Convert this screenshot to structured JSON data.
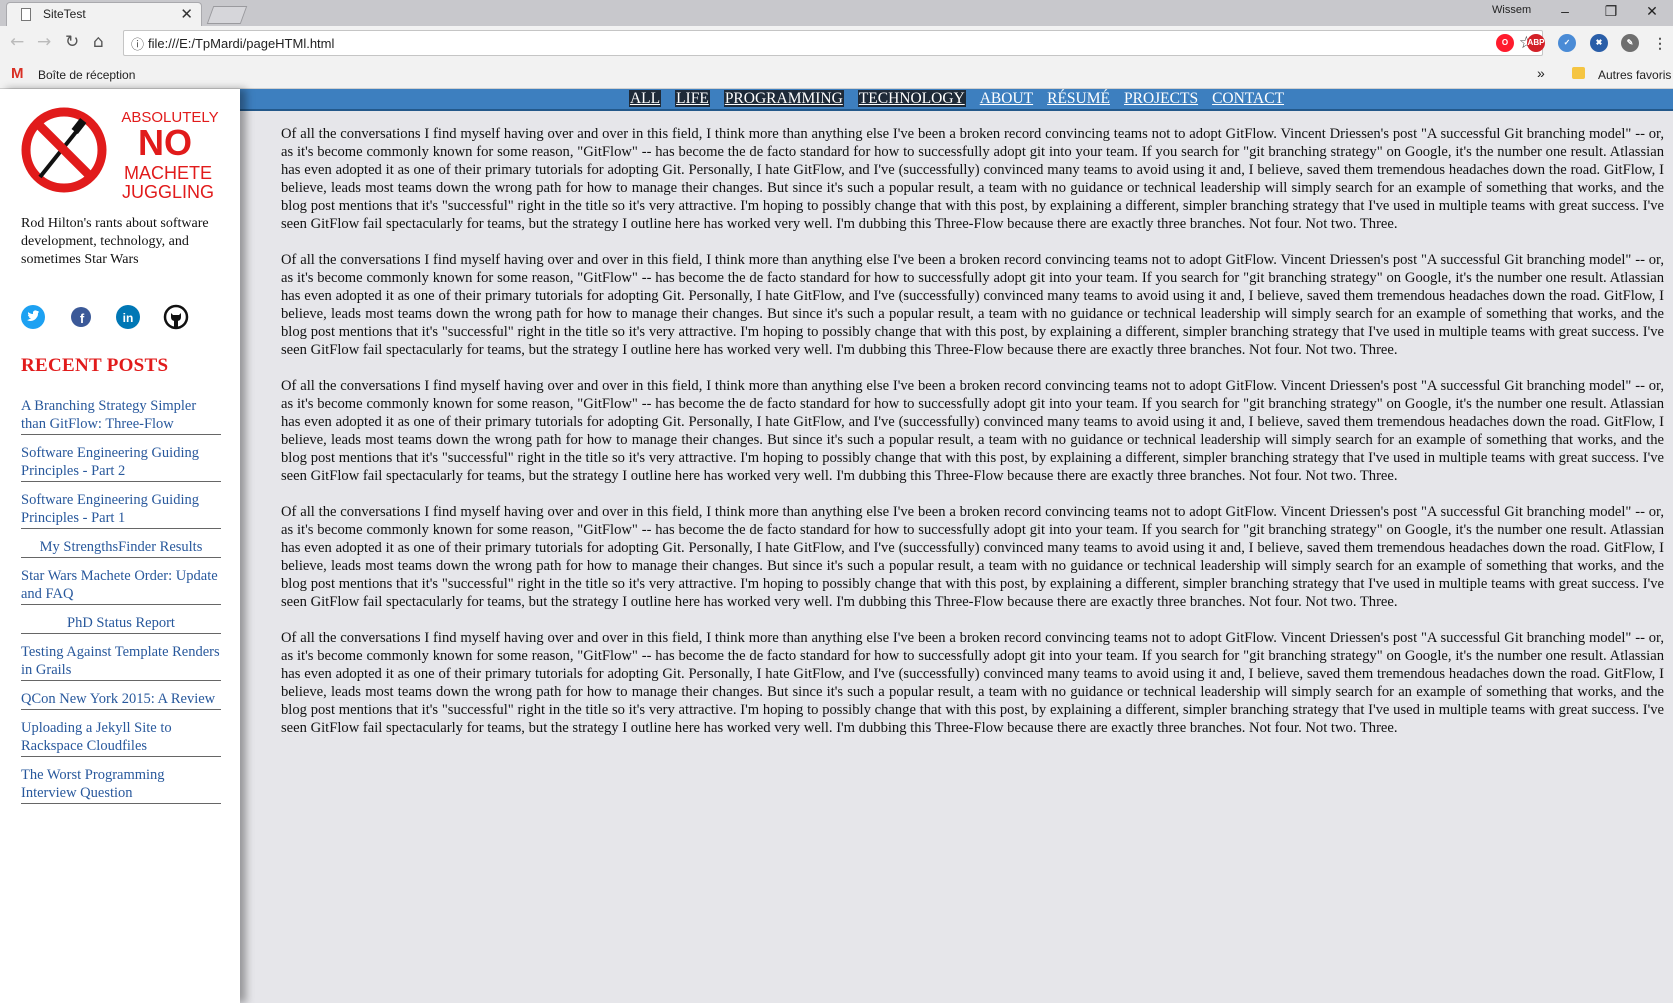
{
  "browser": {
    "tab_title": "SiteTest",
    "tab_close": "✕",
    "user_name": "Wissem",
    "url": "file:///E:/TpMardi/pageHTMl.html",
    "bookmark_gmail": "Boîte de réception",
    "bookmark_more": "»",
    "bookmark_other": "Autres favoris",
    "extensions": [
      "opera-icon",
      "adblock-plus-icon",
      "shield-icon",
      "globe-icon",
      "pen-icon"
    ]
  },
  "nav": {
    "items": [
      {
        "label": "ALL",
        "active": true
      },
      {
        "label": "LIFE",
        "active": true
      },
      {
        "label": "PROGRAMMING",
        "active": true
      },
      {
        "label": "TECHNOLOGY",
        "active": true
      },
      {
        "label": "ABOUT",
        "active": false
      },
      {
        "label": "RÉSUMÉ",
        "active": false
      },
      {
        "label": "PROJECTS",
        "active": false
      },
      {
        "label": "CONTACT",
        "active": false
      }
    ]
  },
  "sidebar": {
    "logo": {
      "line1": "ABSOLUTELY",
      "line2": "NO",
      "line3": "MACHETE",
      "line4": "JUGGLING",
      "color": "#e11b1b"
    },
    "tagline": "Rod Hilton's rants about software development, technology, and sometimes Star Wars",
    "social": [
      "twitter-icon",
      "facebook-icon",
      "linkedin-icon",
      "github-icon"
    ],
    "recent_title": "RECENT POSTS",
    "posts": [
      {
        "title": "A Branching Strategy Simpler than GitFlow: Three-Flow",
        "centered": false
      },
      {
        "title": "Software Engineering Guiding Principles - Part 2",
        "centered": false
      },
      {
        "title": "Software Engineering Guiding Principles - Part 1",
        "centered": false
      },
      {
        "title": "My StrengthsFinder Results",
        "centered": true
      },
      {
        "title": "Star Wars Machete Order: Update and FAQ",
        "centered": false
      },
      {
        "title": "PhD Status Report",
        "centered": true
      },
      {
        "title": "Testing Against Template Renders in Grails",
        "centered": false
      },
      {
        "title": "QCon New York 2015: A Review",
        "centered": false
      },
      {
        "title": "Uploading a Jekyll Site to Rackspace Cloudfiles",
        "centered": false
      },
      {
        "title": "The Worst Programming Interview Question",
        "centered": false
      }
    ]
  },
  "content": {
    "paragraphs": [
      "Of all the conversations I find myself having over and over in this field, I think more than anything else I've been a broken record convincing teams not to adopt GitFlow. Vincent Driessen's post \"A successful Git branching model\" -- or, as it's become commonly known for some reason, \"GitFlow\" -- has become the de facto standard for how to successfully adopt git into your team. If you search for \"git branching strategy\" on Google, it's the number one result. Atlassian has even adopted it as one of their primary tutorials for adopting Git. Personally, I hate GitFlow, and I've (successfully) convinced many teams to avoid using it and, I believe, saved them tremendous headaches down the road. GitFlow, I believe, leads most teams down the wrong path for how to manage their changes. But since it's such a popular result, a team with no guidance or technical leadership will simply search for an example of something that works, and the blog post mentions that it's \"successful\" right in the title so it's very attractive. I'm hoping to possibly change that with this post, by explaining a different, simpler branching strategy that I've used in multiple teams with great success. I've seen GitFlow fail spectacularly for teams, but the strategy I outline here has worked very well. I'm dubbing this Three-Flow because there are exactly three branches. Not four. Not two. Three.",
      "Of all the conversations I find myself having over and over in this field, I think more than anything else I've been a broken record convincing teams not to adopt GitFlow. Vincent Driessen's post \"A successful Git branching model\" -- or, as it's become commonly known for some reason, \"GitFlow\" -- has become the de facto standard for how to successfully adopt git into your team. If you search for \"git branching strategy\" on Google, it's the number one result. Atlassian has even adopted it as one of their primary tutorials for adopting Git. Personally, I hate GitFlow, and I've (successfully) convinced many teams to avoid using it and, I believe, saved them tremendous headaches down the road. GitFlow, I believe, leads most teams down the wrong path for how to manage their changes. But since it's such a popular result, a team with no guidance or technical leadership will simply search for an example of something that works, and the blog post mentions that it's \"successful\" right in the title so it's very attractive. I'm hoping to possibly change that with this post, by explaining a different, simpler branching strategy that I've used in multiple teams with great success. I've seen GitFlow fail spectacularly for teams, but the strategy I outline here has worked very well. I'm dubbing this Three-Flow because there are exactly three branches. Not four. Not two. Three.",
      "Of all the conversations I find myself having over and over in this field, I think more than anything else I've been a broken record convincing teams not to adopt GitFlow. Vincent Driessen's post \"A successful Git branching model\" -- or, as it's become commonly known for some reason, \"GitFlow\" -- has become the de facto standard for how to successfully adopt git into your team. If you search for \"git branching strategy\" on Google, it's the number one result. Atlassian has even adopted it as one of their primary tutorials for adopting Git. Personally, I hate GitFlow, and I've (successfully) convinced many teams to avoid using it and, I believe, saved them tremendous headaches down the road. GitFlow, I believe, leads most teams down the wrong path for how to manage their changes. But since it's such a popular result, a team with no guidance or technical leadership will simply search for an example of something that works, and the blog post mentions that it's \"successful\" right in the title so it's very attractive. I'm hoping to possibly change that with this post, by explaining a different, simpler branching strategy that I've used in multiple teams with great success. I've seen GitFlow fail spectacularly for teams, but the strategy I outline here has worked very well. I'm dubbing this Three-Flow because there are exactly three branches. Not four. Not two. Three.",
      "Of all the conversations I find myself having over and over in this field, I think more than anything else I've been a broken record convincing teams not to adopt GitFlow. Vincent Driessen's post \"A successful Git branching model\" -- or, as it's become commonly known for some reason, \"GitFlow\" -- has become the de facto standard for how to successfully adopt git into your team. If you search for \"git branching strategy\" on Google, it's the number one result. Atlassian has even adopted it as one of their primary tutorials for adopting Git. Personally, I hate GitFlow, and I've (successfully) convinced many teams to avoid using it and, I believe, saved them tremendous headaches down the road. GitFlow, I believe, leads most teams down the wrong path for how to manage their changes. But since it's such a popular result, a team with no guidance or technical leadership will simply search for an example of something that works, and the blog post mentions that it's \"successful\" right in the title so it's very attractive. I'm hoping to possibly change that with this post, by explaining a different, simpler branching strategy that I've used in multiple teams with great success. I've seen GitFlow fail spectacularly for teams, but the strategy I outline here has worked very well. I'm dubbing this Three-Flow because there are exactly three branches. Not four. Not two. Three.",
      "Of all the conversations I find myself having over and over in this field, I think more than anything else I've been a broken record convincing teams not to adopt GitFlow. Vincent Driessen's post \"A successful Git branching model\" -- or, as it's become commonly known for some reason, \"GitFlow\" -- has become the de facto standard for how to successfully adopt git into your team. If you search for \"git branching strategy\" on Google, it's the number one result. Atlassian has even adopted it as one of their primary tutorials for adopting Git. Personally, I hate GitFlow, and I've (successfully) convinced many teams to avoid using it and, I believe, saved them tremendous headaches down the road. GitFlow, I believe, leads most teams down the wrong path for how to manage their changes. But since it's such a popular result, a team with no guidance or technical leadership will simply search for an example of something that works, and the blog post mentions that it's \"successful\" right in the title so it's very attractive. I'm hoping to possibly change that with this post, by explaining a different, simpler branching strategy that I've used in multiple teams with great success. I've seen GitFlow fail spectacularly for teams, but the strategy I outline here has worked very well. I'm dubbing this Three-Flow because there are exactly three branches. Not four. Not two. Three."
    ]
  },
  "colors": {
    "accent_red": "#e11b1b",
    "nav_blue": "#3d7fbf",
    "link_blue": "#28589c",
    "page_bg": "#e6e6ea"
  }
}
